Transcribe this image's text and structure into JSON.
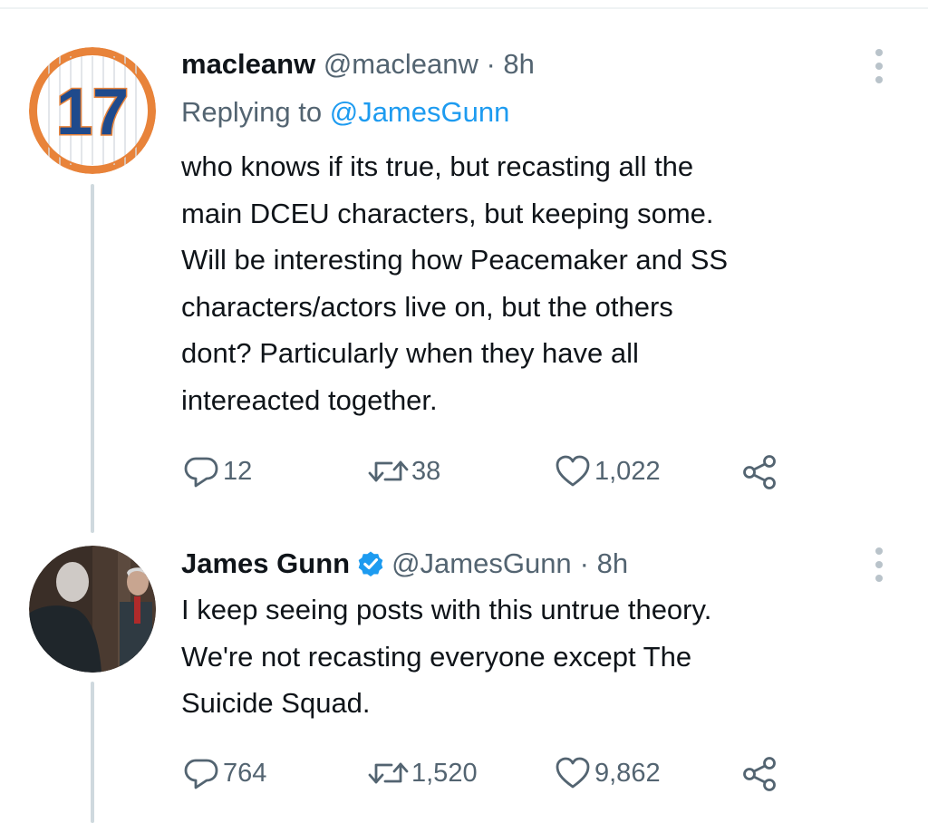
{
  "tweet1": {
    "display_name": "macleanw",
    "handle": "@macleanw",
    "time": "· 8h",
    "replying_prefix": "Replying to",
    "replying_handle": "@JamesGunn",
    "avatar_number": "17",
    "lines": [
      "who knows if its true, but recasting all the",
      "main DCEU characters, but keeping some.",
      "Will be interesting how Peacemaker and SS",
      "characters/actors live on, but the others",
      "dont?  Particularly when they have all",
      "intereacted together."
    ],
    "replies": "12",
    "retweets": "38",
    "likes": "1,022"
  },
  "tweet2": {
    "display_name": "James Gunn",
    "handle": "@JamesGunn",
    "time": "· 8h",
    "verified": true,
    "lines": [
      "I keep seeing posts with this untrue theory.",
      "We're not recasting everyone except The",
      "Suicide Squad."
    ],
    "replies": "764",
    "retweets": "1,520",
    "likes": "9,862"
  },
  "colors": {
    "link": "#1d9bf0",
    "muted": "#536471",
    "thread_line": "#cfd9de",
    "avatar_ring": "#e8833a",
    "avatar_number": "#1f4a8c"
  },
  "icons": [
    "reply-icon",
    "retweet-icon",
    "like-icon",
    "share-icon",
    "more-icon",
    "verified-badge-icon"
  ]
}
